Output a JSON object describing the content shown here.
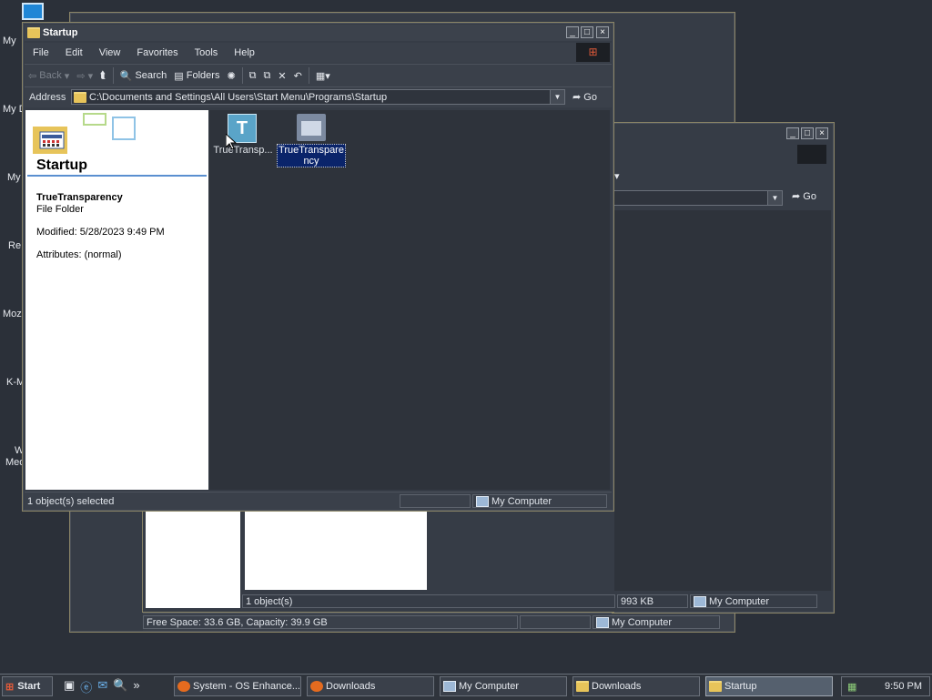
{
  "desktop": {
    "icon_labels": [
      "My",
      "My D",
      "My",
      "Re",
      "Moz",
      "K-M",
      "W",
      "Med"
    ]
  },
  "bg_window2": {
    "go_label": "Go",
    "status": [
      "1 object(s)",
      "993 KB",
      "My Computer"
    ]
  },
  "bg_window3": {
    "status": [
      "Free Space: 33.6 GB, Capacity: 39.9 GB",
      "",
      "My Computer"
    ]
  },
  "startup_window": {
    "title": "Startup",
    "menu": [
      "File",
      "Edit",
      "View",
      "Favorites",
      "Tools",
      "Help"
    ],
    "toolbar": {
      "back": "Back",
      "search": "Search",
      "folders": "Folders"
    },
    "address": {
      "label": "Address",
      "path": "C:\\Documents and Settings\\All Users\\Start Menu\\Programs\\Startup",
      "go": "Go"
    },
    "side_panel": {
      "title": "Startup",
      "item_name": "TrueTransparency",
      "item_type": "File Folder",
      "modified": "Modified: 5/28/2023 9:49 PM",
      "attributes": "Attributes: (normal)"
    },
    "files": [
      {
        "label": "TrueTransp...",
        "icon": "truetransparency-app-icon",
        "selected": false
      },
      {
        "label": "TrueTranspare ncy",
        "label_line1": "TrueTranspare",
        "label_line2": "ncy",
        "icon": "folder-icon",
        "selected": true
      }
    ],
    "status": [
      "1 object(s) selected",
      "",
      "My Computer"
    ]
  },
  "taskbar": {
    "start": "Start",
    "tasks": [
      "System - OS Enhance...",
      "Downloads",
      "My Computer",
      "Downloads",
      "Startup"
    ],
    "clock": "9:50 PM",
    "chevron": "»"
  },
  "colors": {
    "desktop": "#2b3039",
    "selection": "#0a246a",
    "window_frame": "#8a8466"
  }
}
